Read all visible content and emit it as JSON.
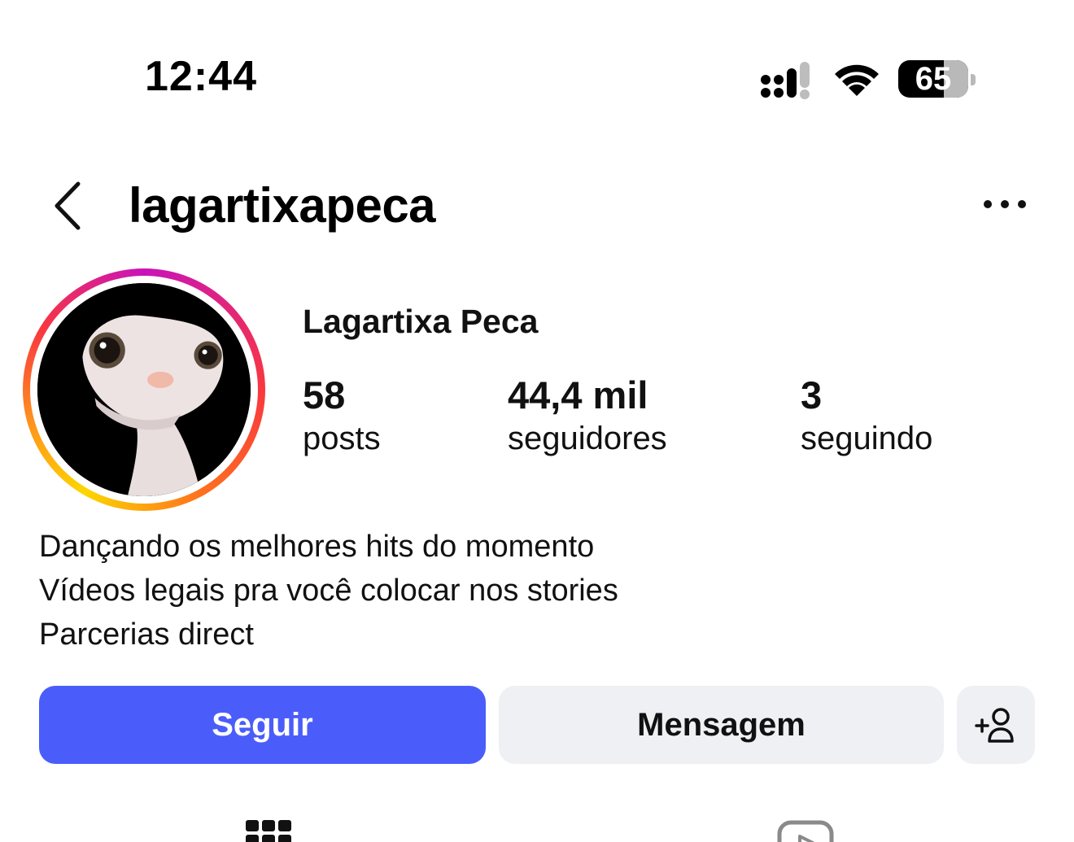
{
  "status_bar": {
    "time": "12:44",
    "battery_percent": "65",
    "icons": [
      "signal-icon",
      "wifi-icon",
      "battery-icon"
    ]
  },
  "header": {
    "username": "lagartixapeca",
    "icons": [
      "back-icon",
      "more-options-icon"
    ]
  },
  "profile": {
    "display_name": "Lagartixa Peca",
    "stats": {
      "posts": {
        "value": "58",
        "label": "posts"
      },
      "followers": {
        "value": "44,4 mil",
        "label": "seguidores"
      },
      "following": {
        "value": "3",
        "label": "seguindo"
      }
    },
    "bio": [
      "Dançando os melhores hits do momento",
      "Vídeos legais pra você colocar nos stories",
      "Parcerias direct"
    ]
  },
  "actions": {
    "follow_label": "Seguir",
    "message_label": "Mensagem",
    "add_user_icon": "add-user-icon"
  },
  "tabs": [
    "grid-icon",
    "reels-icon"
  ],
  "colors": {
    "follow_button": "#4a5dfb",
    "secondary_button": "#eff0f3",
    "story_ring_start": "#c913b9",
    "story_ring_end": "#fdd600"
  }
}
